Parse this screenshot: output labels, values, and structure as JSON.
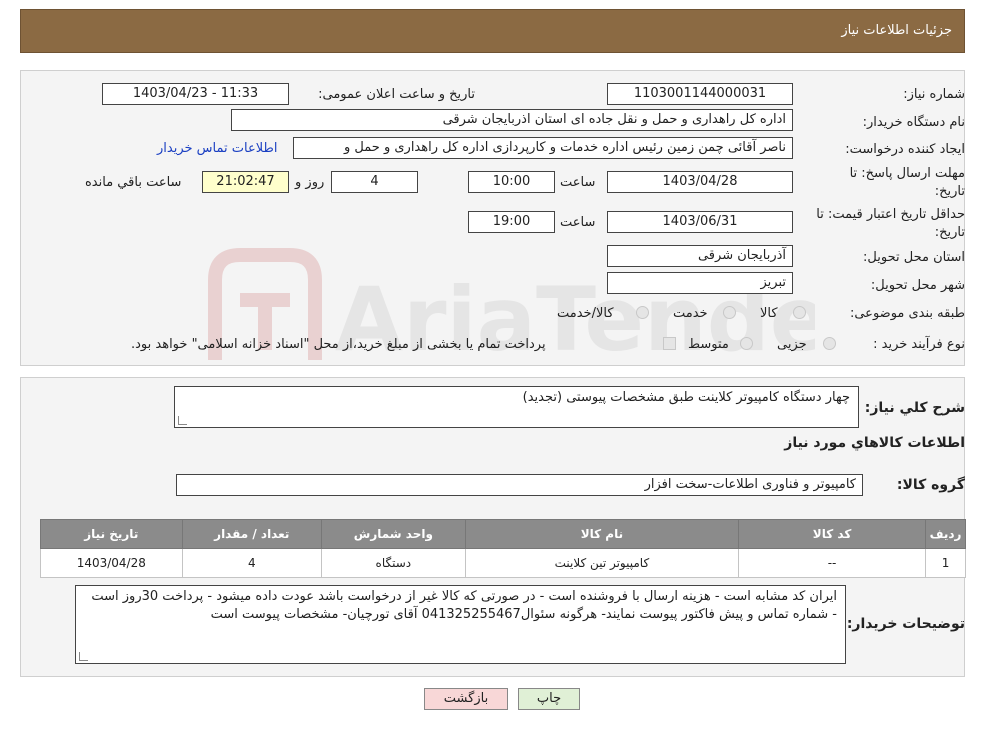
{
  "header": {
    "title": "جزئیات اطلاعات نیاز"
  },
  "fields": {
    "need_number_label": "شماره نیاز:",
    "need_number": "1103001144000031",
    "announce_label": "تاریخ و ساعت اعلان عمومی:",
    "announce_value": "1403/04/23 - 11:33",
    "buyer_label": "نام دستگاه خریدار:",
    "buyer_value": "اداره کل راهداری و حمل و نقل جاده ای استان اذربایجان شرقی",
    "creator_label": "ایجاد کننده درخواست:",
    "creator_value": "ناصر آقائی چمن زمین رئیس اداره خدمات و کارپردازی اداره کل راهداری و حمل و",
    "contact_link": "اطلاعات تماس خریدار",
    "deadline_label_1": "مهلت ارسال پاسخ: تا",
    "deadline_label_2": "تاریخ:",
    "deadline_date": "1403/04/28",
    "time_word": "ساعت",
    "deadline_time": "10:00",
    "days_value": "4",
    "days_word": "روز و",
    "remaining_time": "21:02:47",
    "remaining_word": "ساعت باقي مانده",
    "validity_label_1": "حداقل تاریخ اعتبار قیمت: تا",
    "validity_label_2": "تاریخ:",
    "validity_date": "1403/06/31",
    "validity_time": "19:00",
    "province_label": "استان محل تحویل:",
    "province_value": "آذربایجان شرقی",
    "city_label": "شهر محل تحویل:",
    "city_value": "تبریز",
    "category_label": "طبقه بندی موضوعی:",
    "category_options": [
      "کالا",
      "خدمت",
      "کالا/خدمت"
    ],
    "process_label": "نوع فرآیند خرید :",
    "process_options": [
      "جزیی",
      "متوسط"
    ],
    "process_note": "پرداخت تمام یا بخشی از مبلغ خرید،از محل \"اسناد خزانه اسلامی\" خواهد بود."
  },
  "summary": {
    "label": "شرح کلي نياز:",
    "value": "چهار دستگاه کامپیوتر کلاینت طبق مشخصات پیوستی (تجدید)",
    "goods_info_title": "اطلاعات کالاهاي مورد نياز",
    "group_label": "گروه کالا:",
    "group_value": "کامپیوتر و فناوری اطلاعات-سخت افزار"
  },
  "table": {
    "headers": [
      "ردیف",
      "کد کالا",
      "نام کالا",
      "واحد شمارش",
      "تعداد / مقدار",
      "تاریخ نیاز"
    ],
    "rows": [
      [
        "1",
        "--",
        "کامپیوتر تین کلاینت",
        "دستگاه",
        "4",
        "1403/04/28"
      ]
    ]
  },
  "buyer_notes": {
    "label": "توضیحات خریدار:",
    "value": "ایران کد مشابه است - هزینه ارسال با فروشنده است - در صورتی که کالا غیر از درخواست باشد عودت داده میشود - پرداخت 30روز است - شماره تماس و پیش فاکتور پیوست نمایند-  هرگونه سئوال041325255467 آقای تورچیان- مشخصات پیوست است"
  },
  "buttons": {
    "print": "چاپ",
    "back": "بازگشت"
  },
  "watermark": {
    "text": "AriaTender.neT"
  },
  "colors": {
    "header_bg": "#8b6a43",
    "table_header_bg": "#8b8b8b",
    "remaining_bg": "#ffffcc",
    "back_btn_bg": "#f8d7d7",
    "print_btn_bg": "#e0f0d6"
  }
}
